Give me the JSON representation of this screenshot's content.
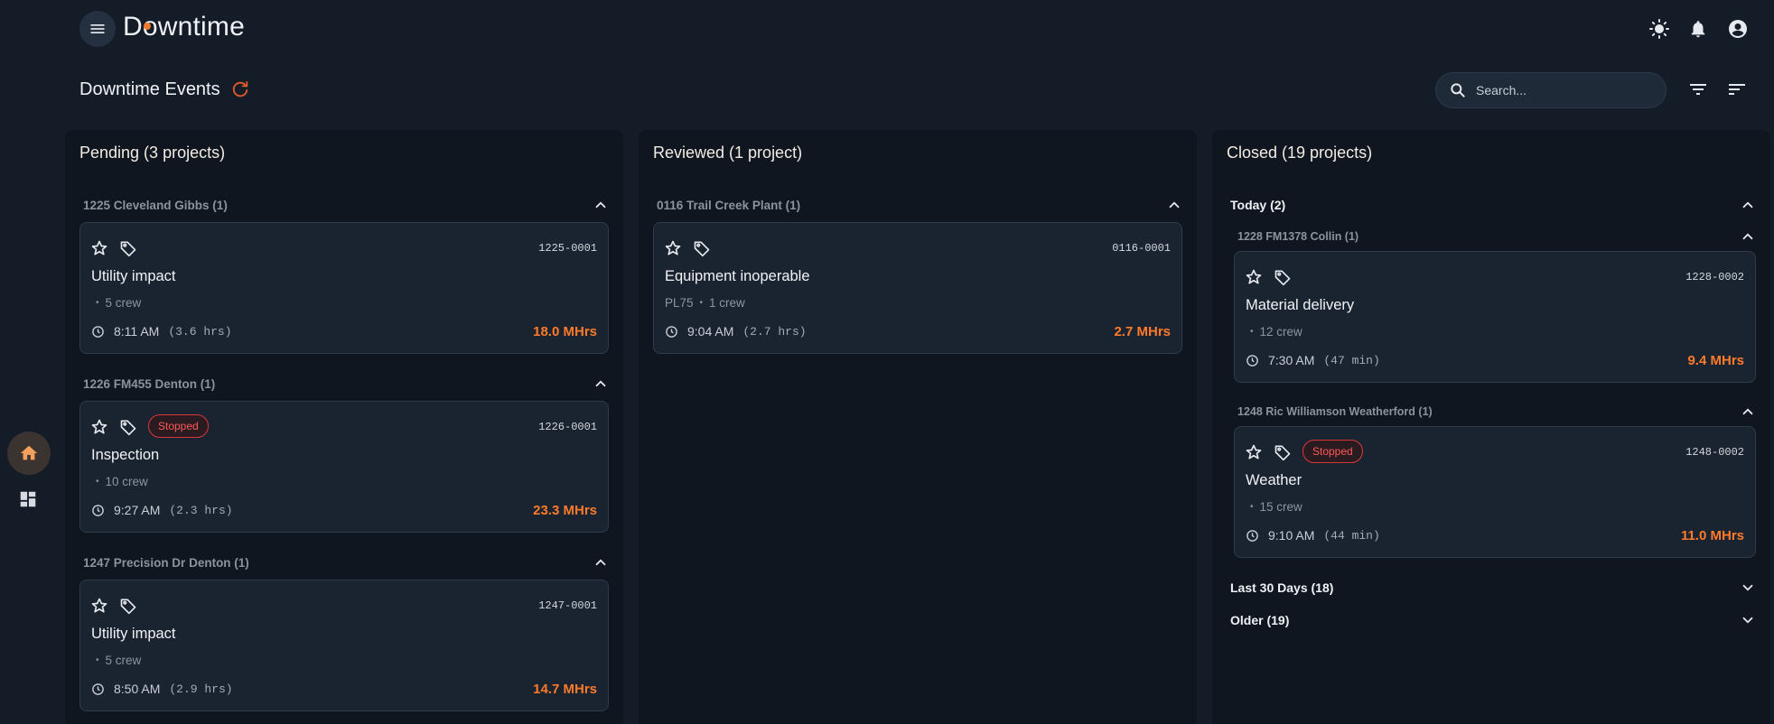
{
  "app": {
    "title": "Downtime"
  },
  "page": {
    "title": "Downtime Events"
  },
  "search": {
    "placeholder": "Search..."
  },
  "colors": {
    "accent": "#ff7a2b",
    "danger": "#ff5a5a",
    "background": "#131c27"
  },
  "columns": [
    {
      "title": "Pending (3 projects)",
      "groups": [
        {
          "label": "1225 Cleveland Gibbs (1)",
          "card": {
            "code": "1225-0001",
            "title": "Utility impact",
            "equipment": "",
            "crew": "5 crew",
            "time": "8:11 AM",
            "duration": "(3.6 hrs)",
            "mhrs": "18.0 MHrs",
            "badge": ""
          }
        },
        {
          "label": "1226 FM455 Denton (1)",
          "card": {
            "code": "1226-0001",
            "title": "Inspection",
            "equipment": "",
            "crew": "10 crew",
            "time": "9:27 AM",
            "duration": "(2.3 hrs)",
            "mhrs": "23.3 MHrs",
            "badge": "Stopped"
          }
        },
        {
          "label": "1247 Precision Dr Denton (1)",
          "card": {
            "code": "1247-0001",
            "title": "Utility impact",
            "equipment": "",
            "crew": "5 crew",
            "time": "8:50 AM",
            "duration": "(2.9 hrs)",
            "mhrs": "14.7 MHrs",
            "badge": ""
          }
        }
      ]
    },
    {
      "title": "Reviewed (1 project)",
      "groups": [
        {
          "label": "0116 Trail Creek Plant (1)",
          "card": {
            "code": "0116-0001",
            "title": "Equipment inoperable",
            "equipment": "PL75",
            "crew": "1 crew",
            "time": "9:04 AM",
            "duration": "(2.7 hrs)",
            "mhrs": "2.7 MHrs",
            "badge": ""
          }
        }
      ]
    },
    {
      "title": "Closed (19 projects)",
      "sections": [
        {
          "label": "Today (2)",
          "subgroups": [
            {
              "label": "1228 FM1378 Collin (1)",
              "card": {
                "code": "1228-0002",
                "title": "Material delivery",
                "equipment": "",
                "crew": "12 crew",
                "time": "7:30 AM",
                "duration": "(47 min)",
                "mhrs": "9.4 MHrs",
                "badge": ""
              }
            },
            {
              "label": "1248 Ric Williamson Weatherford (1)",
              "card": {
                "code": "1248-0002",
                "title": "Weather",
                "equipment": "",
                "crew": "15 crew",
                "time": "9:10 AM",
                "duration": "(44 min)",
                "mhrs": "11.0 MHrs",
                "badge": "Stopped"
              }
            }
          ]
        },
        {
          "label": "Last 30 Days (18)"
        },
        {
          "label": "Older (19)"
        }
      ]
    }
  ]
}
